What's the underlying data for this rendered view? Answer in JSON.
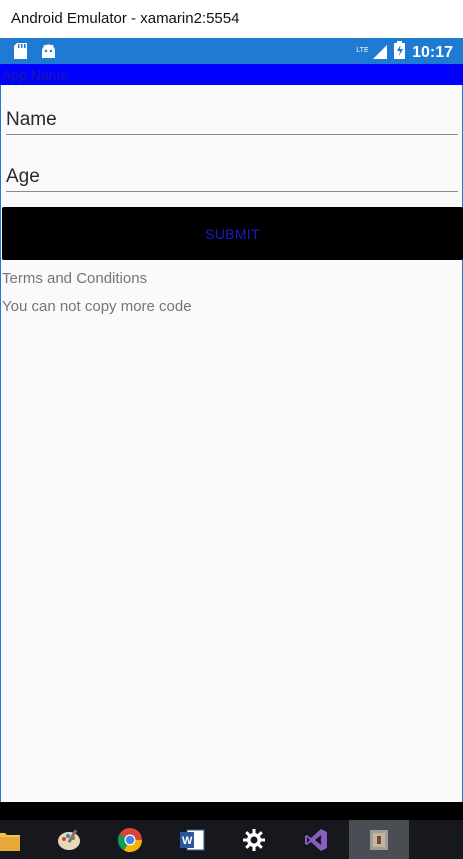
{
  "window": {
    "title": "Android Emulator - xamarin2:5554"
  },
  "statusbar": {
    "time": "10:17",
    "network": "LTE"
  },
  "appbar": {
    "title": "App Name"
  },
  "form": {
    "name_placeholder": "Name",
    "age_placeholder": "Age",
    "submit_label": "Submit"
  },
  "content": {
    "terms": "Terms and Conditions",
    "note": "You can not copy more code"
  },
  "taskbar": {
    "icons": [
      "folder-icon",
      "paint-icon",
      "chrome-icon",
      "word-icon",
      "settings-icon",
      "visual-studio-icon",
      "emulator-icon"
    ]
  },
  "colors": {
    "statusbar": "#1e7bd1",
    "appbar": "#0000ff",
    "button": "#000000",
    "button_text": "#1a1acc"
  }
}
